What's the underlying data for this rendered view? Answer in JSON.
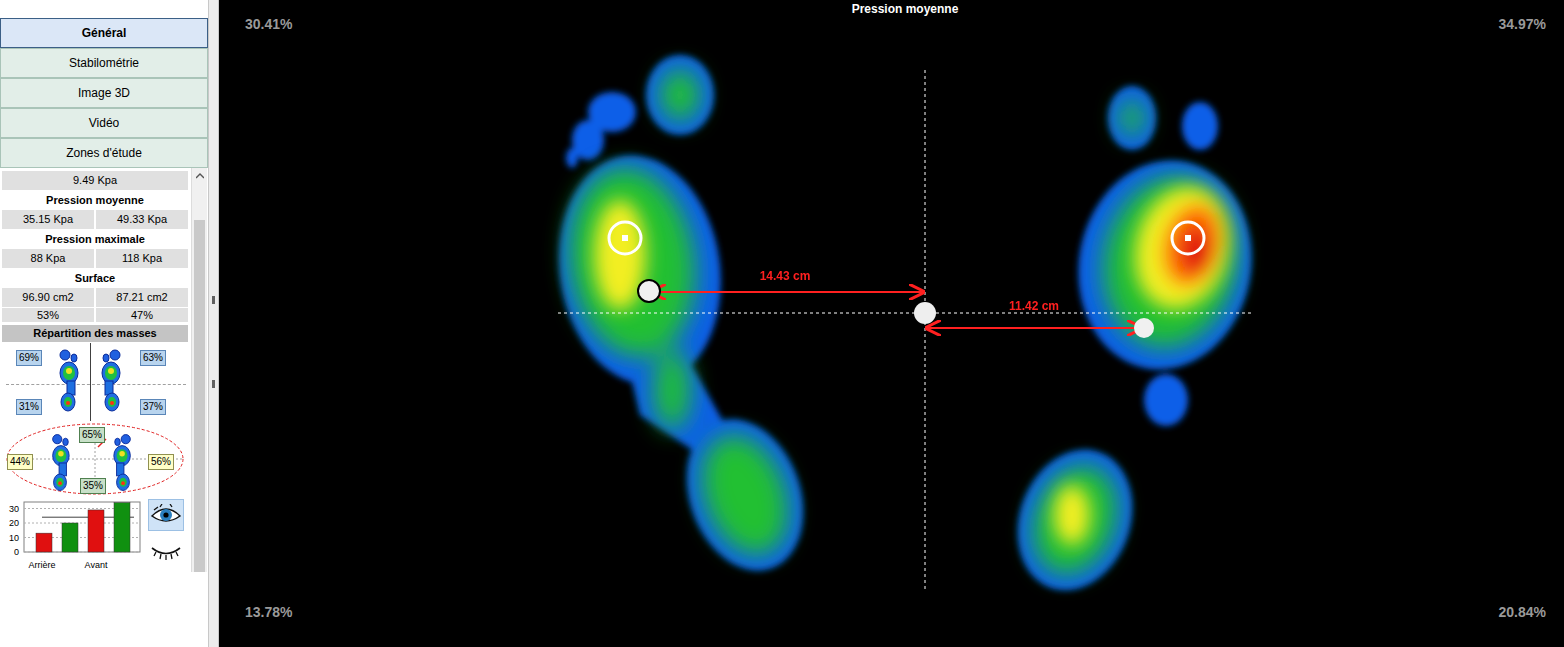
{
  "tabs": [
    {
      "label": "Général",
      "selected": true
    },
    {
      "label": "Stabilométrie",
      "selected": false
    },
    {
      "label": "Image 3D",
      "selected": false
    },
    {
      "label": "Vidéo",
      "selected": false
    },
    {
      "label": "Zones d'étude",
      "selected": false
    }
  ],
  "stats": {
    "top_value": "9.49 Kpa",
    "sections": [
      {
        "title": "Pression moyenne",
        "values": [
          "35.15 Kpa",
          "49.33 Kpa"
        ]
      },
      {
        "title": "Pression maximale",
        "values": [
          "88 Kpa",
          "118 Kpa"
        ]
      },
      {
        "title": "Surface",
        "values": [
          "96.90 cm2",
          "87.21 cm2"
        ]
      }
    ],
    "surface_percent": [
      "53%",
      "47%"
    ]
  },
  "mass_distribution": {
    "title": "Répartition des masses",
    "feet": {
      "left_front": "69%",
      "right_front": "63%",
      "left_back": "31%",
      "right_back": "37%"
    },
    "balance": {
      "top": "65%",
      "bottom": "35%",
      "left": "44%",
      "right": "56%"
    }
  },
  "chart": {
    "ticks": [
      "30",
      "20",
      "10",
      "0"
    ],
    "groups": [
      "Arrière",
      "Avant"
    ],
    "series": [
      {
        "color": "#e01010",
        "values": [
          13,
          29
        ]
      },
      {
        "color": "#109010",
        "values": [
          20,
          34
        ]
      }
    ],
    "reference": 24
  },
  "eye_toggle": [
    {
      "kind": "open",
      "selected": true
    },
    {
      "kind": "closed",
      "selected": false
    }
  ],
  "canvas": {
    "title": "Pression moyenne",
    "corners": {
      "top_left": "30.41%",
      "top_right": "34.97%",
      "bottom_left": "13.78%",
      "bottom_right": "20.84%"
    },
    "distances": {
      "left": "14.43 cm",
      "right": "11.42 cm"
    }
  }
}
